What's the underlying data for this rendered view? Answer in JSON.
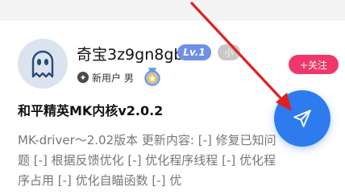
{
  "author": {
    "username": "奇宝3z9gn8gb",
    "level_badge": "Lv.1",
    "secondary_badge": "小",
    "tag_text": "新用户 男",
    "avatar_icon": "ghost-avatar-icon",
    "medal_icon": "medal-icon"
  },
  "follow_button": {
    "label": "+关注"
  },
  "post": {
    "title": "和平精英MK内核v2.0.2",
    "body": "MK-driver～2.02版本 更新内容: [-] 修复已知问题 [-] 根据反馈优化 [-] 优化程序线程 [-] 优化程序占用 [-] 优化自瞄函数 [-] 优"
  },
  "fab": {
    "icon": "send-icon"
  },
  "colors": {
    "accent_blue": "#2e7bf0",
    "follow_pink": "#f0376b",
    "level_blue": "#6f8fe8",
    "annotation_red": "#e02020"
  }
}
